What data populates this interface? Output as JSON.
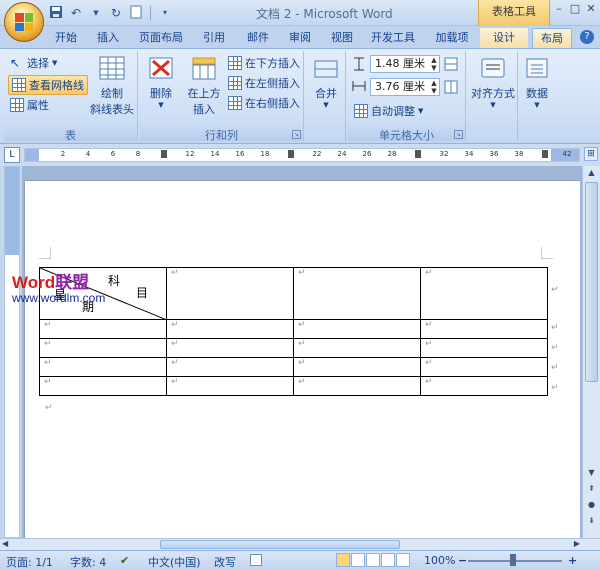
{
  "title_bar": {
    "title": "文档 2 - Microsoft Word",
    "context_tool_label": "表格工具"
  },
  "tabs": [
    {
      "label": "开始"
    },
    {
      "label": "插入"
    },
    {
      "label": "页面布局"
    },
    {
      "label": "引用"
    },
    {
      "label": "邮件"
    },
    {
      "label": "审阅"
    },
    {
      "label": "视图"
    },
    {
      "label": "开发工具"
    },
    {
      "label": "加载项"
    },
    {
      "label": "设计"
    },
    {
      "label": "布局"
    }
  ],
  "ribbon": {
    "table_group": {
      "select": "选择",
      "view_gridlines": "查看网格线",
      "properties": "属性",
      "draw_diagonal_line1": "绘制",
      "draw_diagonal_line2": "斜线表头",
      "label": "表"
    },
    "rows_cols_group": {
      "delete": "删除",
      "insert_above1": "在上方",
      "insert_above2": "插入",
      "insert_below": "在下方插入",
      "insert_left": "在左侧插入",
      "insert_right": "在右侧插入",
      "label": "行和列"
    },
    "merge_group": {
      "merge": "合并"
    },
    "cell_size_group": {
      "height": "1.48 厘米",
      "width": "3.76 厘米",
      "autofit": "自动调整",
      "label": "单元格大小"
    },
    "alignment": "对齐方式",
    "data": "数据"
  },
  "ruler": {
    "ticks": [
      "2",
      "4",
      "6",
      "8",
      "",
      "12",
      "14",
      "16",
      "18",
      "",
      "22",
      "24",
      "26",
      "28",
      "",
      "32",
      "34",
      "36",
      "38",
      "",
      "42"
    ]
  },
  "document": {
    "diag_header": {
      "subject_a": "科",
      "subject_b": "目",
      "date_a": "星",
      "date_b": "期"
    },
    "para_mark": "↵"
  },
  "watermark": {
    "logo_word": "Word",
    "logo_cn": "联盟",
    "url": "www.wordlm.com"
  },
  "status_bar": {
    "page": "页面: 1/1",
    "words": "字数: 4",
    "language": "中文(中国)",
    "mode": "改写",
    "zoom": "100%"
  },
  "colors": {
    "accent": "#15428b",
    "ribbon_bg": "#dfe9f7",
    "context_tab": "#f6d98a"
  }
}
